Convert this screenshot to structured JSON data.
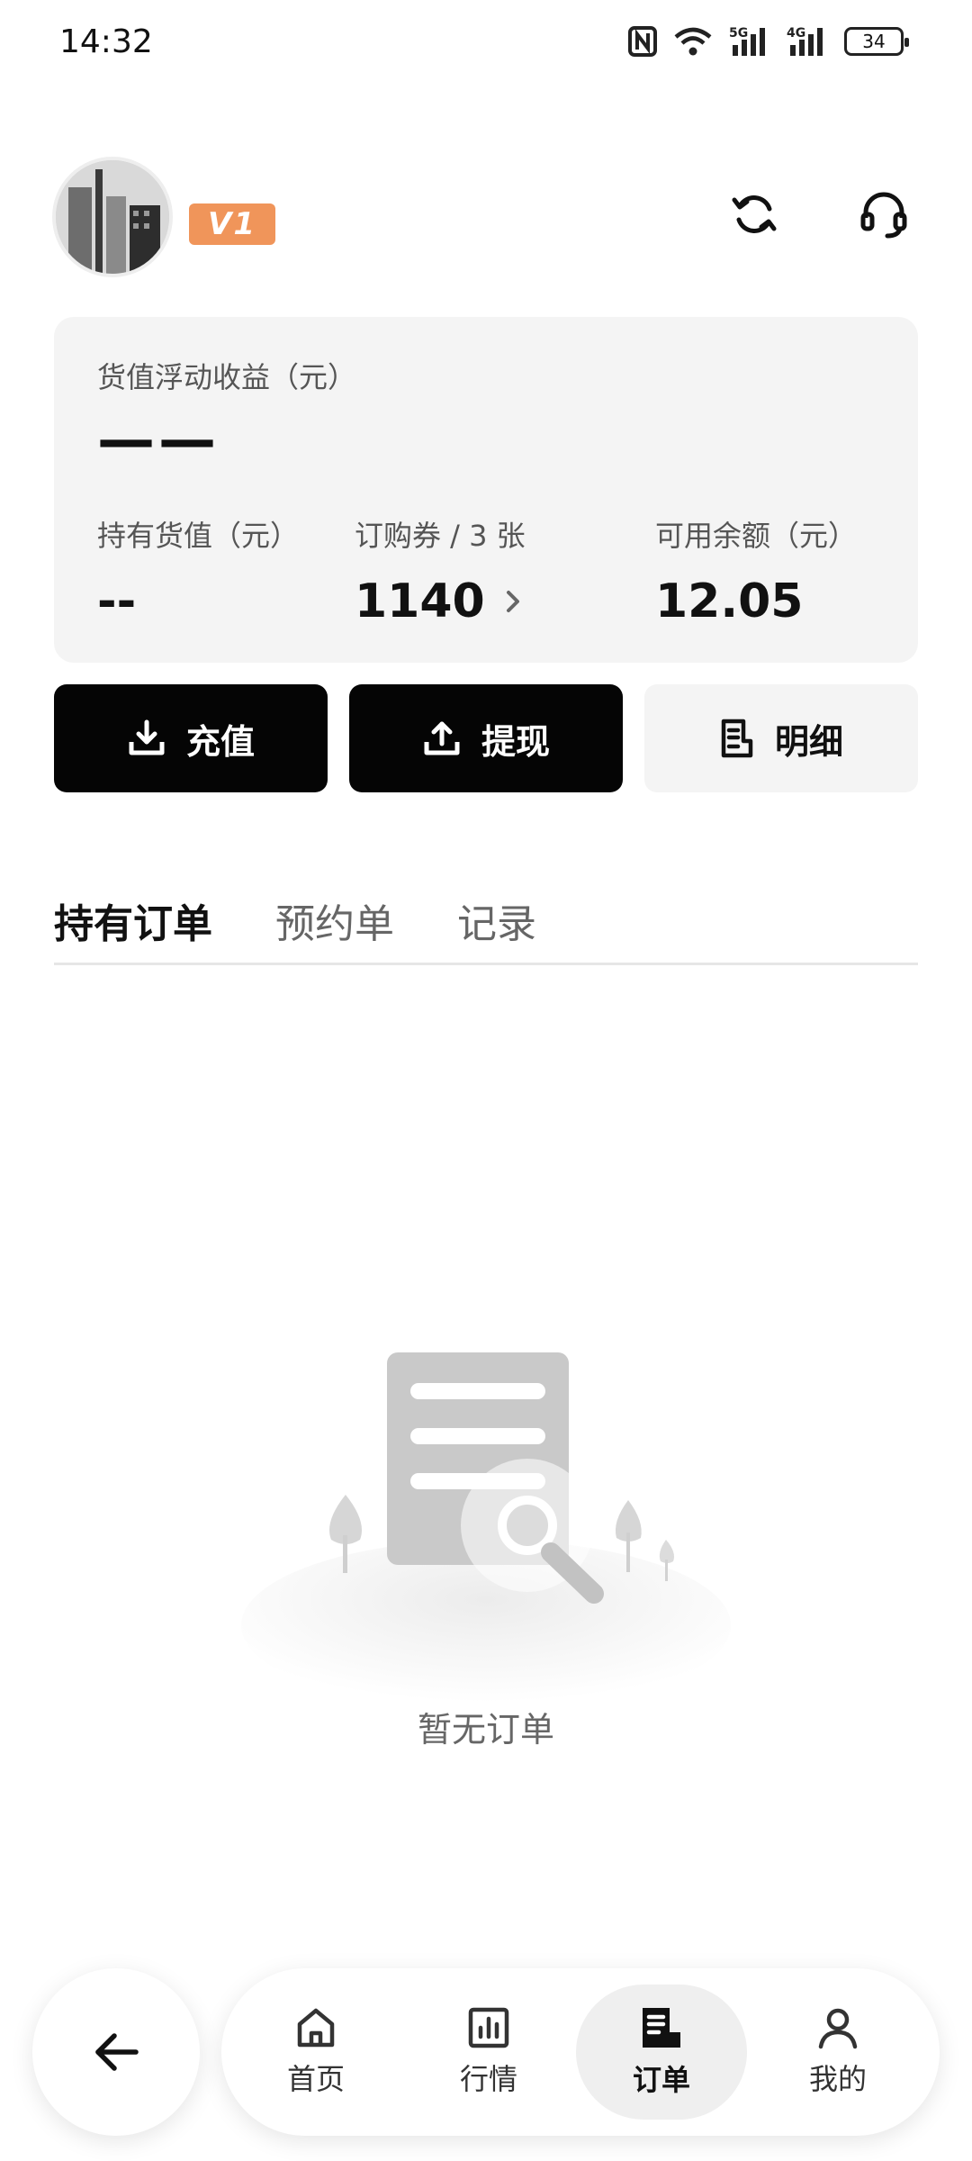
{
  "status_bar": {
    "time": "14:32",
    "icons": [
      "nfc-icon",
      "wifi-icon",
      "signal-5g-icon",
      "signal-4g-icon"
    ],
    "signal_5g": "5G",
    "signal_4g": "4G",
    "battery": "34"
  },
  "header": {
    "vip_level": "V1",
    "icons": [
      "refresh-icon",
      "headset-icon"
    ],
    "colors": {
      "vip_badge": "#f0955a"
    }
  },
  "summary": {
    "floating_profit_label": "货值浮动收益（元）",
    "floating_profit_value": "——",
    "holding_label": "持有货值（元）",
    "holding_value": "--",
    "coupon_label": "订购券 / 3 张",
    "coupon_value": "1140",
    "balance_label": "可用余额（元）",
    "balance_value": "12.05"
  },
  "actions": {
    "recharge": "充值",
    "withdraw": "提现",
    "detail": "明细"
  },
  "tabs": [
    {
      "label": "持有订单",
      "active": true
    },
    {
      "label": "预约单",
      "active": false
    },
    {
      "label": "记录",
      "active": false
    }
  ],
  "empty_state": {
    "text": "暂无订单",
    "icon": "empty-order-illustration"
  },
  "bottom_nav": {
    "back_icon": "arrow-left-icon",
    "items": [
      {
        "label": "首页",
        "icon": "home-icon",
        "active": false
      },
      {
        "label": "行情",
        "icon": "chart-icon",
        "active": false
      },
      {
        "label": "订单",
        "icon": "order-icon",
        "active": true
      },
      {
        "label": "我的",
        "icon": "user-icon",
        "active": false
      }
    ]
  }
}
